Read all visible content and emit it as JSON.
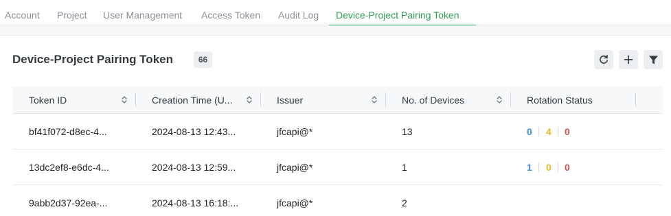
{
  "tabs": [
    {
      "label": "Account",
      "active": false
    },
    {
      "label": "Project",
      "active": false
    },
    {
      "label": "User Management",
      "active": false
    },
    {
      "label": "Access Token",
      "active": false
    },
    {
      "label": "Audit Log",
      "active": false
    },
    {
      "label": "Device-Project Pairing Token",
      "active": true
    }
  ],
  "header": {
    "title": "Device-Project Pairing Token",
    "count": "66"
  },
  "toolbar": {
    "buttons": [
      {
        "name": "refresh",
        "icon": "refresh-icon"
      },
      {
        "name": "add",
        "icon": "plus-icon"
      },
      {
        "name": "filter",
        "icon": "filter-icon"
      }
    ]
  },
  "table": {
    "columns": [
      "Token ID",
      "Creation Time (U...",
      "Issuer",
      "No. of Devices",
      "Rotation Status"
    ],
    "rows": [
      {
        "token_id": "bf41f072-d8ec-4...",
        "creation_time": "2024-08-13 12:43...",
        "issuer": "jfcapi@*",
        "devices": "13",
        "rotation": [
          "0",
          "4",
          "0"
        ]
      },
      {
        "token_id": "13dc2ef8-e6dc-4...",
        "creation_time": "2024-08-13 12:59...",
        "issuer": "jfcapi@*",
        "devices": "1",
        "rotation": [
          "1",
          "0",
          "0"
        ]
      },
      {
        "token_id": "9abb2d37-92ea-...",
        "creation_time": "2024-08-13 16:18:...",
        "issuer": "jfcapi@*",
        "devices": "2",
        "rotation": []
      }
    ]
  },
  "colors": {
    "accent": "#2e9d55",
    "rotation_blue": "#3d8fd9",
    "rotation_yellow": "#e8b923",
    "rotation_red": "#d9534f"
  }
}
